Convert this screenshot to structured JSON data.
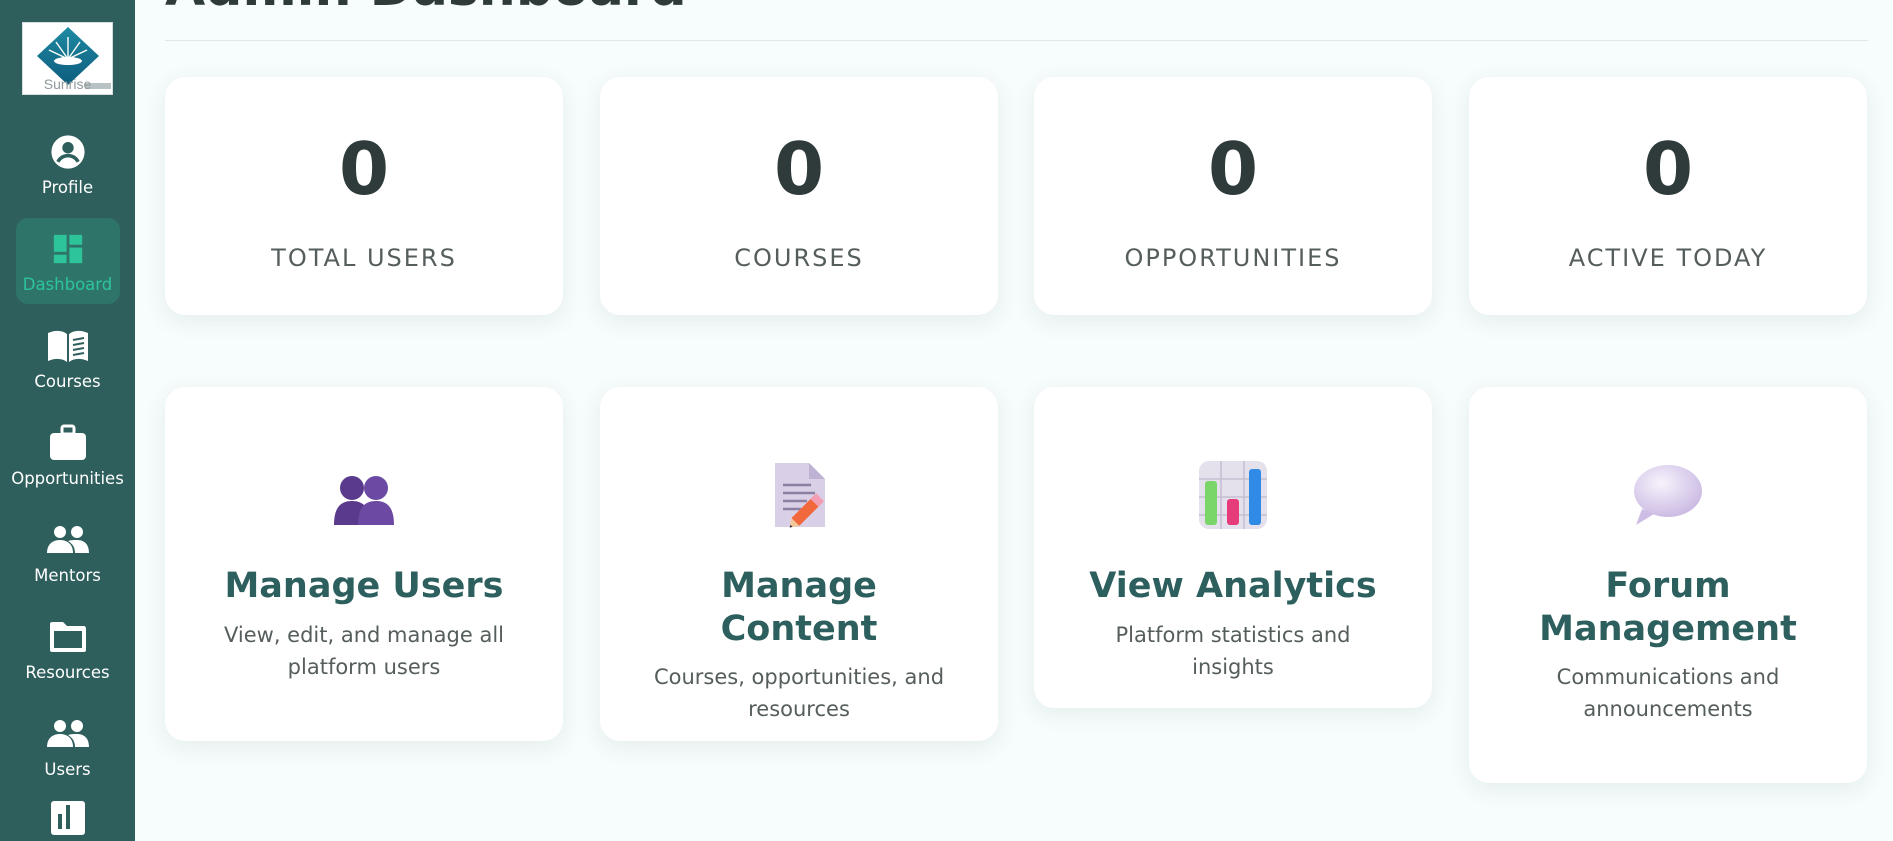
{
  "brand": {
    "logo_text": "Sunrise"
  },
  "sidebar": {
    "items": [
      {
        "label": "Profile",
        "icon": "user-circle-icon"
      },
      {
        "label": "Dashboard",
        "icon": "dashboard-icon",
        "active": true
      },
      {
        "label": "Courses",
        "icon": "book-icon"
      },
      {
        "label": "Opportunities",
        "icon": "briefcase-icon"
      },
      {
        "label": "Mentors",
        "icon": "group-icon"
      },
      {
        "label": "Resources",
        "icon": "folder-icon"
      },
      {
        "label": "Users",
        "icon": "group-icon"
      }
    ],
    "partial_item_icon": "analytics-icon"
  },
  "page": {
    "title": "Admin Dashboard"
  },
  "stats": [
    {
      "value": "0",
      "label": "TOTAL USERS"
    },
    {
      "value": "0",
      "label": "COURSES"
    },
    {
      "value": "0",
      "label": "OPPORTUNITIES"
    },
    {
      "value": "0",
      "label": "ACTIVE TODAY"
    }
  ],
  "actions": [
    {
      "title": "Manage Users",
      "description": "View, edit, and manage all platform users",
      "icon": "users-silhouette-icon"
    },
    {
      "title": "Manage Content",
      "description": "Courses, opportunities, and resources",
      "icon": "document-pencil-icon"
    },
    {
      "title": "View Analytics",
      "description": "Platform statistics and insights",
      "icon": "bar-chart-icon"
    },
    {
      "title": "Forum Management",
      "description": "Communications and announcements",
      "icon": "speech-bubble-icon"
    }
  ],
  "colors": {
    "sidebar": "#2e5f5c",
    "active_item_bg": "#2f7468",
    "active_item_text": "#2ec49a",
    "action_title": "#2c5f5d",
    "page_bg": "#f7fcfc"
  }
}
